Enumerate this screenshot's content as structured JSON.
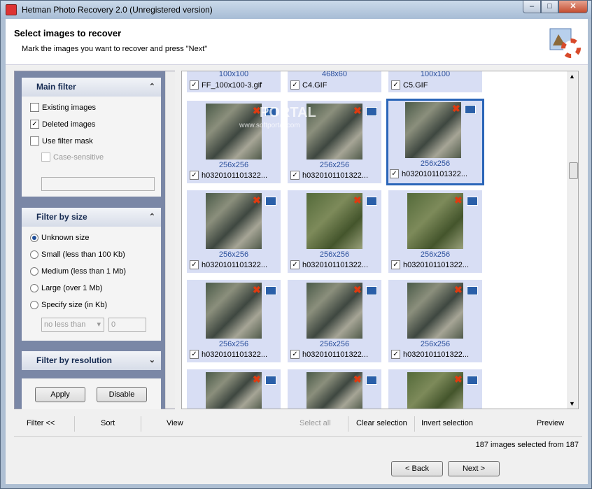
{
  "window": {
    "title": "Hetman Photo Recovery 2.0 (Unregistered version)"
  },
  "header": {
    "title": "Select images to recover",
    "subtitle": "Mark the images you want to recover and press \"Next\""
  },
  "main_filter": {
    "heading": "Main filter",
    "existing": "Existing images",
    "existing_checked": false,
    "deleted": "Deleted images",
    "deleted_checked": true,
    "mask": "Use filter mask",
    "mask_checked": false,
    "case": "Case-sensitive"
  },
  "size_filter": {
    "heading": "Filter by size",
    "options": [
      "Unknown size",
      "Small (less than 100 Kb)",
      "Medium (less than 1 Mb)",
      "Large (over 1 Mb)",
      "Specify size (in Kb)"
    ],
    "selected": "Unknown size",
    "range_select": "no less than",
    "range_value": "0"
  },
  "resolution_filter": {
    "heading": "Filter by resolution"
  },
  "filter_buttons": {
    "apply": "Apply",
    "disable": "Disable"
  },
  "top_tiles": [
    {
      "res": "100x100",
      "name": "FF_100x100-3.gif"
    },
    {
      "res": "468x60",
      "name": "C4.GIF"
    },
    {
      "res": "100x100",
      "name": "C5.GIF"
    }
  ],
  "tiles": [
    {
      "res": "256x256",
      "name": "h0320101101322..."
    },
    {
      "res": "256x256",
      "name": "h0320101101322..."
    },
    {
      "res": "256x256",
      "name": "h0320101101322..."
    },
    {
      "res": "256x256",
      "name": "h0320101101322..."
    },
    {
      "res": "256x256",
      "name": "h0320101101322..."
    },
    {
      "res": "256x256",
      "name": "h0320101101322..."
    },
    {
      "res": "256x256",
      "name": "h0320101101322..."
    },
    {
      "res": "256x256",
      "name": "h0320101101322..."
    },
    {
      "res": "256x256",
      "name": "h0320101101322..."
    }
  ],
  "watermark": {
    "brand": "PORTAL",
    "url": "www.softportal.com"
  },
  "toolbar": {
    "filter": "Filter <<",
    "sort": "Sort",
    "view": "View",
    "select_all": "Select all",
    "clear": "Clear selection",
    "invert": "Invert selection",
    "preview": "Preview"
  },
  "status": "187 images selected from 187",
  "nav": {
    "back": "< Back",
    "next": "Next >"
  }
}
